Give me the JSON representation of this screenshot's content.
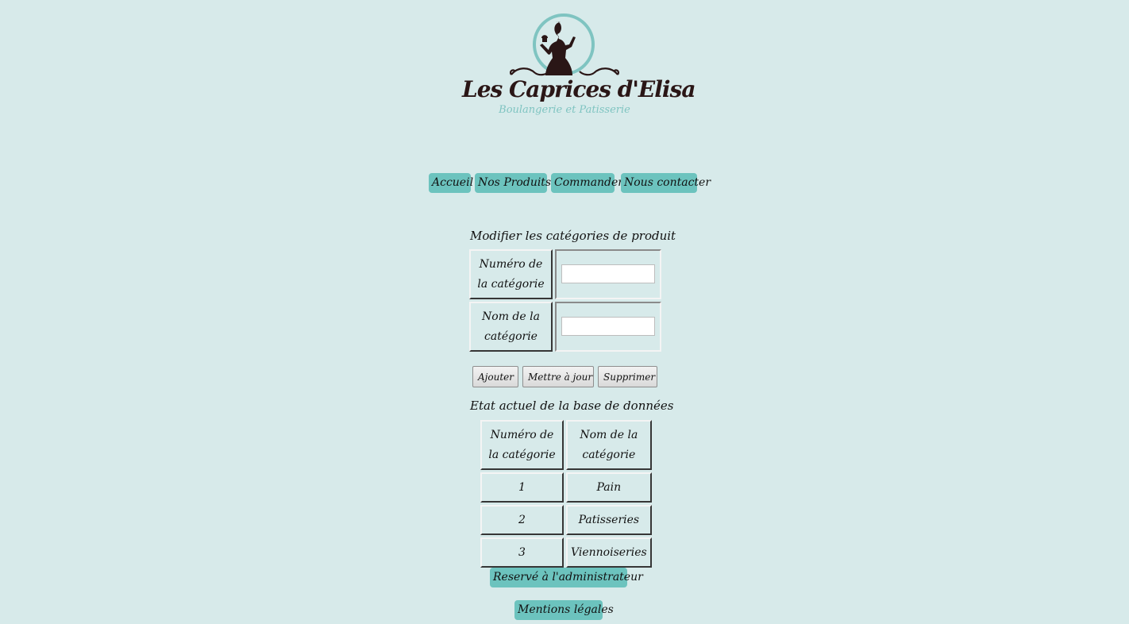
{
  "logo": {
    "title": "Les Caprices d'Elisa",
    "subtitle": "Boulangerie et Patisserie",
    "icon": "baker-woman-cupcake-logo"
  },
  "nav": {
    "items": [
      {
        "label": "Accueil"
      },
      {
        "label": "Nos Produits"
      },
      {
        "label": "Commander"
      },
      {
        "label": "Nous contacter"
      }
    ]
  },
  "form": {
    "title": "Modifier les catégories de produit",
    "number_label": "Numéro de la catégorie",
    "name_label": "Nom de la catégorie",
    "number_value": "",
    "name_value": "",
    "buttons": {
      "add": "Ajouter",
      "update": "Mettre à jour",
      "delete": "Supprimer"
    }
  },
  "db": {
    "title": "Etat actuel de la base de données",
    "headers": [
      "Numéro de la catégorie",
      "Nom de la catégorie"
    ],
    "rows": [
      [
        "1",
        "Pain"
      ],
      [
        "2",
        "Patisseries"
      ],
      [
        "3",
        "Viennoiseries"
      ]
    ]
  },
  "footer": {
    "admin": "Reservé à l'administrateur",
    "legal": "Mentions légales"
  },
  "colors": {
    "background": "#d7eaea",
    "accent": "#6cc3be",
    "logo_text": "#2a1616",
    "logo_subtitle": "#7fc4c1"
  }
}
